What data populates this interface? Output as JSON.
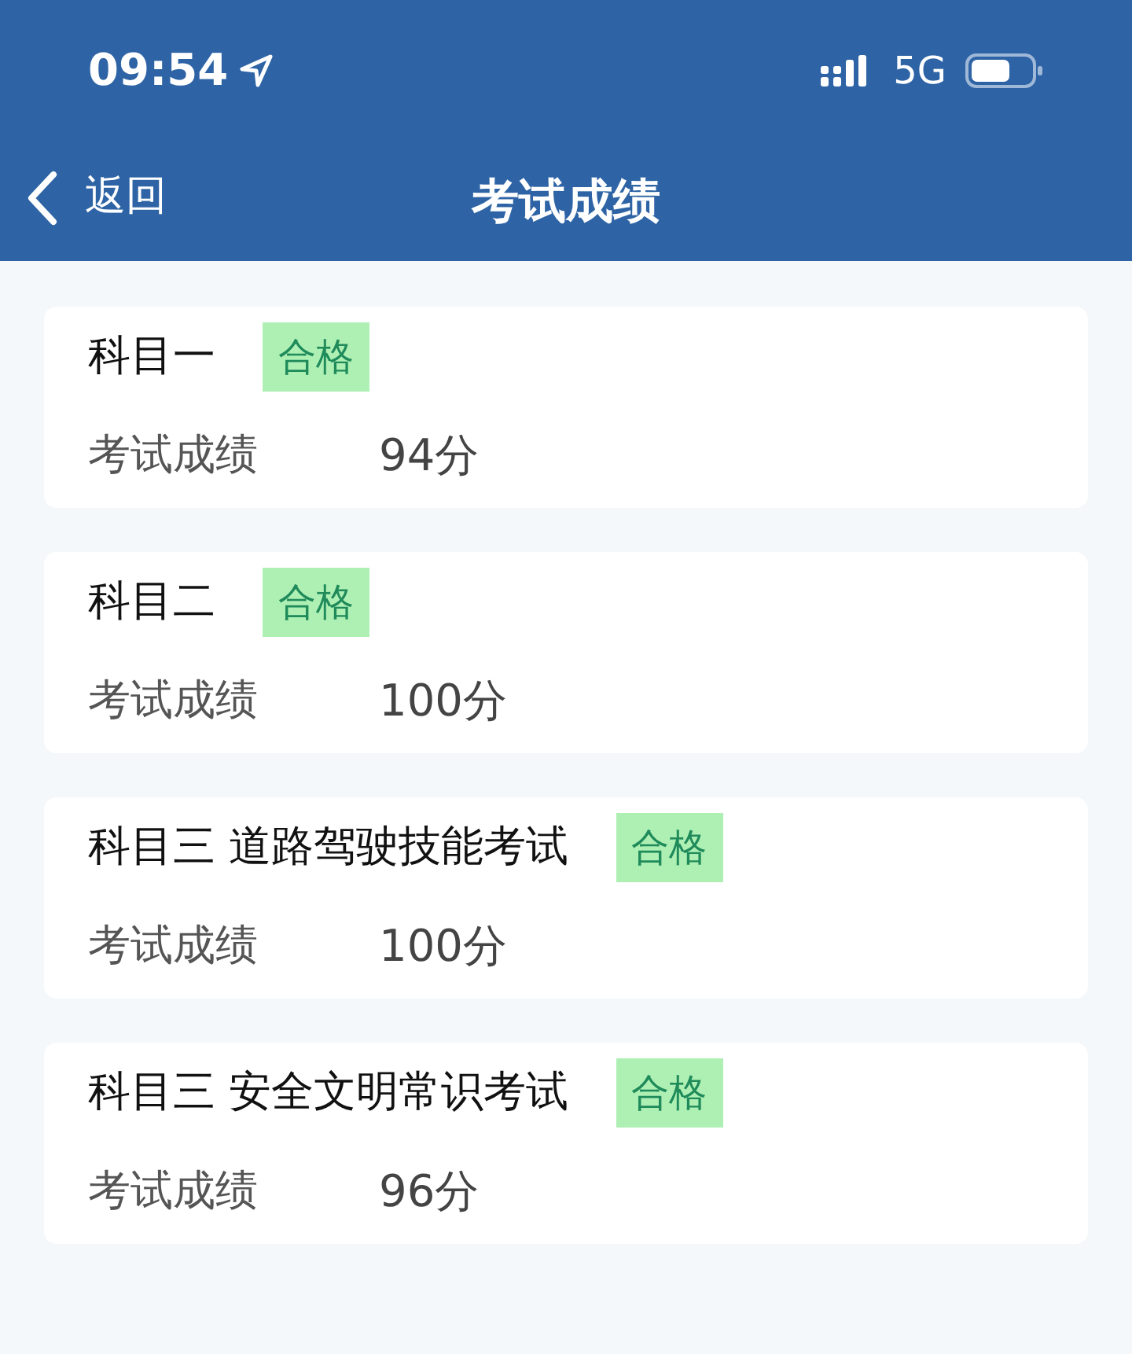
{
  "status_bar": {
    "time": "09:54",
    "network": "5G"
  },
  "nav": {
    "back_label": "返回",
    "title": "考试成绩"
  },
  "results": [
    {
      "subject": "科目一",
      "badge": "合格",
      "score_label": "考试成绩",
      "score": "94分"
    },
    {
      "subject": "科目二",
      "badge": "合格",
      "score_label": "考试成绩",
      "score": "100分"
    },
    {
      "subject": "科目三 道路驾驶技能考试",
      "badge": "合格",
      "score_label": "考试成绩",
      "score": "100分"
    },
    {
      "subject": "科目三 安全文明常识考试",
      "badge": "合格",
      "score_label": "考试成绩",
      "score": "96分"
    }
  ]
}
